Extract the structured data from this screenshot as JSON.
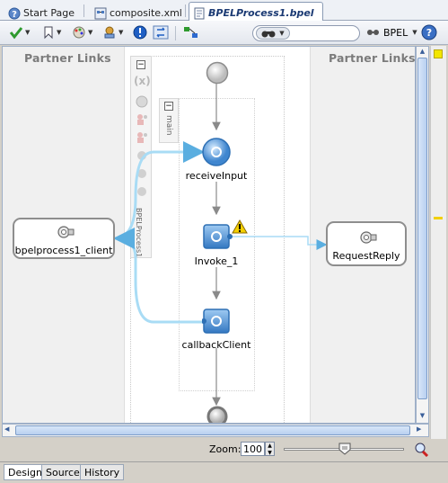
{
  "tabs": [
    {
      "label": "Start Page",
      "icon": "help-circle-icon"
    },
    {
      "label": "composite.xml",
      "icon": "composite-icon"
    },
    {
      "label": "BPELProcess1.bpel",
      "icon": "bpel-file-icon"
    }
  ],
  "toolbar": {
    "bpel_label": "BPEL",
    "search_value": ""
  },
  "canvas": {
    "left_partner_header": "Partner Links",
    "right_partner_header": "Partner Links",
    "scope_label": "main",
    "process_label": "BPELProcess1",
    "variables_symbol": "(x)",
    "left_partner": "bpelprocess1_client",
    "right_partner": "RequestReply",
    "activities": [
      {
        "label": "receiveInput",
        "icon": "receive-icon"
      },
      {
        "label": "Invoke_1",
        "icon": "invoke-icon",
        "warning": true
      },
      {
        "label": "callbackClient",
        "icon": "callback-icon"
      }
    ]
  },
  "zoom": {
    "label": "Zoom:",
    "value": "100",
    "slider_fraction": 0.51
  },
  "bottom_tabs": [
    "Design",
    "Source",
    "History"
  ],
  "colors": {
    "accent": "#5b9bd5",
    "connector": "#9fd3f0",
    "warning": "#f5d000"
  }
}
